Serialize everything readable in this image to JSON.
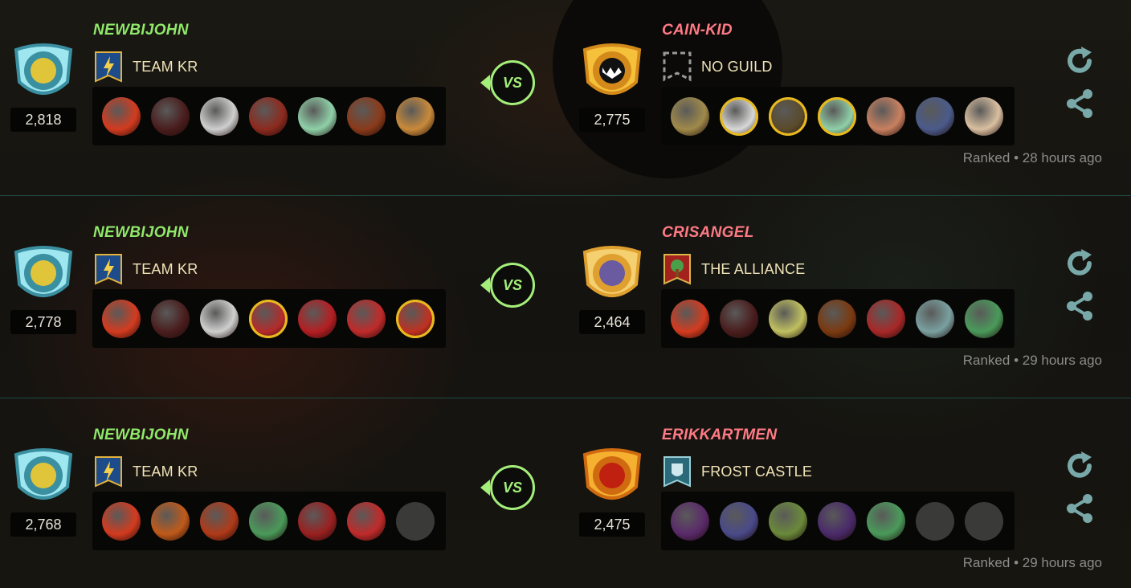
{
  "colors": {
    "winner_name": "#8fe86a",
    "loser_name": "#ff7a84",
    "vs_accent": "#a4ef7a",
    "icon_teal": "#78a9a8",
    "gold_foil": "#e8b91f"
  },
  "battles": [
    {
      "left": {
        "name": "NEWBIJOHN",
        "rating": "2,818",
        "guild": "TEAM KR",
        "guild_icon": "lightning-banner-icon",
        "avatar_icon": "dwarf-shield-icon",
        "cards": [
          {
            "icon": "fire-beast-card-icon",
            "color": "#d33b1f",
            "gold": false
          },
          {
            "icon": "demon-cat-card-icon",
            "color": "#4a1d1d",
            "gold": false
          },
          {
            "icon": "white-chicken-card-icon",
            "color": "#cfcfcf",
            "gold": false
          },
          {
            "icon": "red-warrior-card-icon",
            "color": "#8d2a1e",
            "gold": false
          },
          {
            "icon": "green-spirit-card-icon",
            "color": "#8fd0a8",
            "gold": false
          },
          {
            "icon": "fire-monk-card-icon",
            "color": "#8a3a1a",
            "gold": false
          },
          {
            "icon": "ogre-card-icon",
            "color": "#c98a3a",
            "gold": false
          }
        ]
      },
      "right": {
        "name": "CAIN-KID",
        "rating": "2,775",
        "guild": "NO GUILD",
        "guild_icon": "empty-banner-icon",
        "avatar_icon": "fangs-monster-icon",
        "cards": [
          {
            "icon": "golem-card-icon",
            "color": "#a08a4a",
            "gold": false
          },
          {
            "icon": "white-chicken-card-icon",
            "color": "#d8d8d8",
            "gold": true
          },
          {
            "icon": "armored-tank-card-icon",
            "color": "#5a4a2a",
            "gold": true
          },
          {
            "icon": "green-spirit-card-icon",
            "color": "#8fd0a8",
            "gold": true
          },
          {
            "icon": "hero-boy-card-icon",
            "color": "#c98060",
            "gold": false
          },
          {
            "icon": "blue-knight-card-icon",
            "color": "#4a5a8a",
            "gold": false
          },
          {
            "icon": "pale-beast-card-icon",
            "color": "#d9bfa0",
            "gold": false
          }
        ]
      },
      "meta": "Ranked • 28 hours ago"
    },
    {
      "left": {
        "name": "NEWBIJOHN",
        "rating": "2,778",
        "guild": "TEAM KR",
        "guild_icon": "lightning-banner-icon",
        "avatar_icon": "dwarf-shield-icon",
        "cards": [
          {
            "icon": "fire-beast-card-icon",
            "color": "#d33b1f",
            "gold": false
          },
          {
            "icon": "demon-cat-card-icon",
            "color": "#4a1d1d",
            "gold": false
          },
          {
            "icon": "white-chicken-card-icon",
            "color": "#cfcfcf",
            "gold": false
          },
          {
            "icon": "imp-card-icon",
            "color": "#b52a2a",
            "gold": true
          },
          {
            "icon": "red-devil-card-icon",
            "color": "#b41e22",
            "gold": false
          },
          {
            "icon": "red-devil-card-icon",
            "color": "#c02a2a",
            "gold": false
          },
          {
            "icon": "fire-demon-card-icon",
            "color": "#c03020",
            "gold": true
          }
        ]
      },
      "right": {
        "name": "CRISANGEL",
        "rating": "2,464",
        "guild": "THE ALLIANCE",
        "guild_icon": "tree-banner-icon",
        "avatar_icon": "wizard-shield-icon",
        "cards": [
          {
            "icon": "fire-beast-card-icon",
            "color": "#d33b1f",
            "gold": false
          },
          {
            "icon": "demon-cat-card-icon",
            "color": "#4a1d1d",
            "gold": false
          },
          {
            "icon": "elf-archer-card-icon",
            "color": "#c0c060",
            "gold": false
          },
          {
            "icon": "lava-golem-card-icon",
            "color": "#7a3a10",
            "gold": false
          },
          {
            "icon": "imp-card-icon",
            "color": "#a82828",
            "gold": false
          },
          {
            "icon": "mech-warrior-card-icon",
            "color": "#7aa0a0",
            "gold": false
          },
          {
            "icon": "green-zombie-card-icon",
            "color": "#4a9a5a",
            "gold": false
          }
        ]
      },
      "meta": "Ranked • 29 hours ago"
    },
    {
      "left": {
        "name": "NEWBIJOHN",
        "rating": "2,768",
        "guild": "TEAM KR",
        "guild_icon": "lightning-banner-icon",
        "avatar_icon": "dwarf-shield-icon",
        "cards": [
          {
            "icon": "fire-beast-card-icon",
            "color": "#d33b1f",
            "gold": false
          },
          {
            "icon": "flame-girl-card-icon",
            "color": "#c05a1a",
            "gold": false
          },
          {
            "icon": "fire-imp-card-icon",
            "color": "#b03a18",
            "gold": false
          },
          {
            "icon": "green-zombie-card-icon",
            "color": "#4a9a5a",
            "gold": false
          },
          {
            "icon": "horned-demon-card-icon",
            "color": "#9a2020",
            "gold": false
          },
          {
            "icon": "red-devil-card-icon",
            "color": "#c02a2a",
            "gold": false
          },
          {
            "icon": "empty-slot-icon",
            "color": "",
            "gold": false
          }
        ]
      },
      "right": {
        "name": "ERIKKARTMEN",
        "rating": "2,475",
        "guild": "FROST CASTLE",
        "guild_icon": "frost-shield-banner-icon",
        "avatar_icon": "flaming-skull-shield-icon",
        "cards": [
          {
            "icon": "screaming-ghoul-card-icon",
            "color": "#5a2a6a",
            "gold": false
          },
          {
            "icon": "ice-wisp-card-icon",
            "color": "#4a4a8a",
            "gold": false
          },
          {
            "icon": "goblin-chef-card-icon",
            "color": "#6a8a3a",
            "gold": false
          },
          {
            "icon": "dark-beast-card-icon",
            "color": "#4a2a6a",
            "gold": false
          },
          {
            "icon": "green-zombie-card-icon",
            "color": "#4a9a5a",
            "gold": false
          },
          {
            "icon": "empty-slot-icon",
            "color": "",
            "gold": false
          },
          {
            "icon": "empty-slot-icon",
            "color": "",
            "gold": false
          }
        ]
      },
      "meta": "Ranked • 29 hours ago"
    }
  ],
  "vs_label": "VS",
  "actions": {
    "refresh_icon": "refresh-icon",
    "share_icon": "share-icon"
  }
}
